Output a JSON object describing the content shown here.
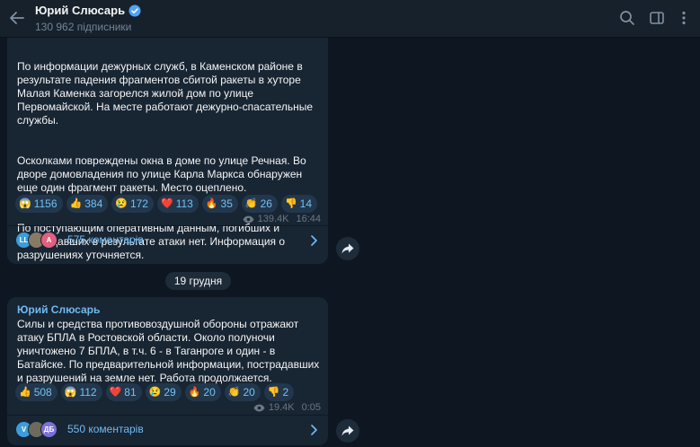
{
  "header": {
    "channel_name": "Юрий Слюсарь",
    "subscribers": "130 962 підписники"
  },
  "messages": [
    {
      "paragraphs": [
        "По информации дежурных служб, в Каменском районе в результате падения фрагментов сбитой ракеты в хуторе Малая Каменка загорелся жилой дом по улице Первомайской. На месте работают дежурно-спасательные службы.",
        "Осколками повреждены окна в доме по улице Речная. Во дворе домовладения по улице Карла Маркса обнаружен еще один фрагмент ракеты. Место оцеплено.",
        "По поступающим оперативным данным, погибших и пострадавших в результате атаки нет. Информация о разрушениях уточняется."
      ],
      "reactions": [
        {
          "emoji": "😱",
          "count": "1156"
        },
        {
          "emoji": "👍",
          "count": "384"
        },
        {
          "emoji": "😢",
          "count": "172"
        },
        {
          "emoji": "❤️",
          "count": "113"
        },
        {
          "emoji": "🔥",
          "count": "35"
        },
        {
          "emoji": "👏",
          "count": "26"
        },
        {
          "emoji": "👎",
          "count": "14"
        }
      ],
      "views": "139.4K",
      "time": "16:44",
      "comment_avatars": [
        "LL",
        "",
        "A"
      ],
      "comments": "575 коментарів"
    },
    {
      "author": "Юрий Слюсарь",
      "text": "Силы и средства противовоздушной обороны отражают атаку БПЛА в Ростовской области. Около полуночи уничтожено 7 БПЛА, в т.ч. 6 - в Таганроге и один - в Батайске. По предварительной информации, пострадавших и разрушений на земле нет. Работа продолжается.",
      "reactions": [
        {
          "emoji": "👍",
          "count": "508"
        },
        {
          "emoji": "😱",
          "count": "112"
        },
        {
          "emoji": "❤️",
          "count": "81"
        },
        {
          "emoji": "😢",
          "count": "29"
        },
        {
          "emoji": "🔥",
          "count": "20"
        },
        {
          "emoji": "👏",
          "count": "20"
        },
        {
          "emoji": "👎",
          "count": "2"
        }
      ],
      "views": "19.4K",
      "time": "0:05",
      "comment_avatars": [
        "V",
        "",
        "ДБ"
      ],
      "comments": "550 коментарів"
    }
  ],
  "date_separator": "19 грудня",
  "colors": {
    "background": "#0e1621",
    "header": "#17212b",
    "bubble": "#182533",
    "accent": "#71baf0",
    "reaction_bg": "#22374c",
    "meta": "#6c7883"
  },
  "icons": [
    "back-arrow-icon",
    "verified-icon",
    "search-icon",
    "sidebar-toggle-icon",
    "more-vertical-icon",
    "eye-icon",
    "chevron-right-icon",
    "share-icon"
  ]
}
